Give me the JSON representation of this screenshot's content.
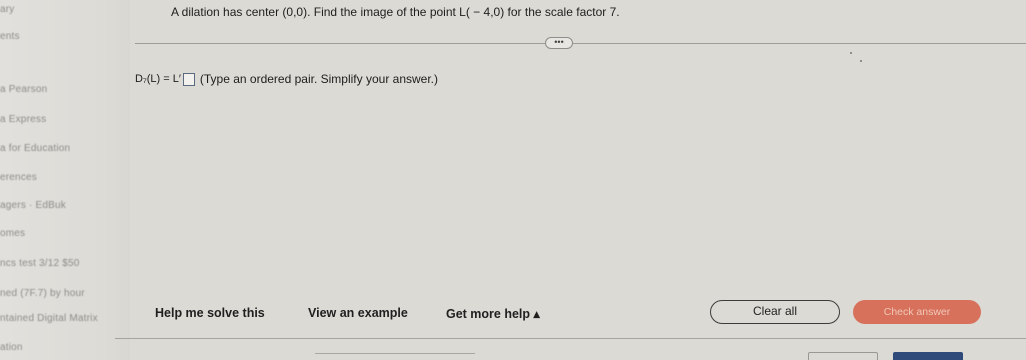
{
  "sidebar": {
    "items": [
      "ary",
      "ents",
      "a Pearson",
      "a Express",
      "a for Education",
      "erences",
      "agers · EdBuk",
      "omes",
      "ncs test 3/12 $50",
      "ned (7F.7) by hour",
      "ntained Digital Matrix",
      "ation"
    ]
  },
  "question": {
    "text": "A dilation has center (0,0). Find the image of the point L( − 4,0) for the scale factor 7."
  },
  "more_button": {
    "label": "•••"
  },
  "answer": {
    "lhs": "D₇(L) = L′",
    "instruction": "(Type an ordered pair. Simplify your answer.)",
    "value": ""
  },
  "toolbar": {
    "help_label": "Help me solve this",
    "example_label": "View an example",
    "more_help_label": "Get more help ▴",
    "clear_label": "Clear all",
    "check_label": "Check answer"
  },
  "colors": {
    "background": "#dcdad5",
    "check_button": "#d7715b"
  }
}
